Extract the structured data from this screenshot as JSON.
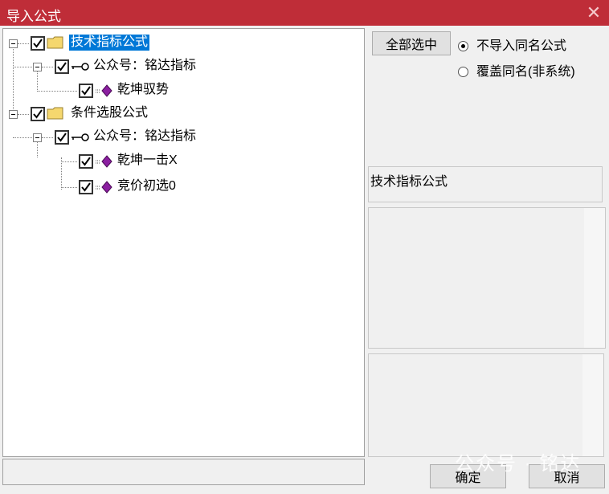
{
  "window": {
    "title": "导入公式",
    "close_glyph": "✕"
  },
  "tree": {
    "nodes": [
      {
        "label": "技术指标公式",
        "checked": true,
        "icon": "folder-icon",
        "selected": true
      },
      {
        "label": "公众号：铭达指标",
        "checked": true,
        "icon": "key-icon"
      },
      {
        "label": "乾坤驭势",
        "checked": true,
        "icon": "formula-icon"
      },
      {
        "label": "条件选股公式",
        "checked": true,
        "icon": "folder-icon"
      },
      {
        "label": "公众号：铭达指标",
        "checked": true,
        "icon": "key-icon"
      },
      {
        "label": "乾坤一击X",
        "checked": true,
        "icon": "formula-icon"
      },
      {
        "label": "竞价初选0",
        "checked": true,
        "icon": "formula-icon"
      }
    ]
  },
  "options": {
    "select_all_label": "全部选中",
    "radio_options": [
      {
        "label": "不导入同名公式",
        "selected": true
      },
      {
        "label": "覆盖同名(非系统)",
        "selected": false
      }
    ]
  },
  "info": {
    "category_text": "技术指标公式"
  },
  "footer": {
    "ok_label": "确定",
    "cancel_label": "取消"
  },
  "watermark": "公众号 · 铭达",
  "colors": {
    "titlebar": "#bf2d38",
    "selection": "#0078d7",
    "formula_icon": "#8b1fa0",
    "folder_icon": "#f5d76e"
  }
}
